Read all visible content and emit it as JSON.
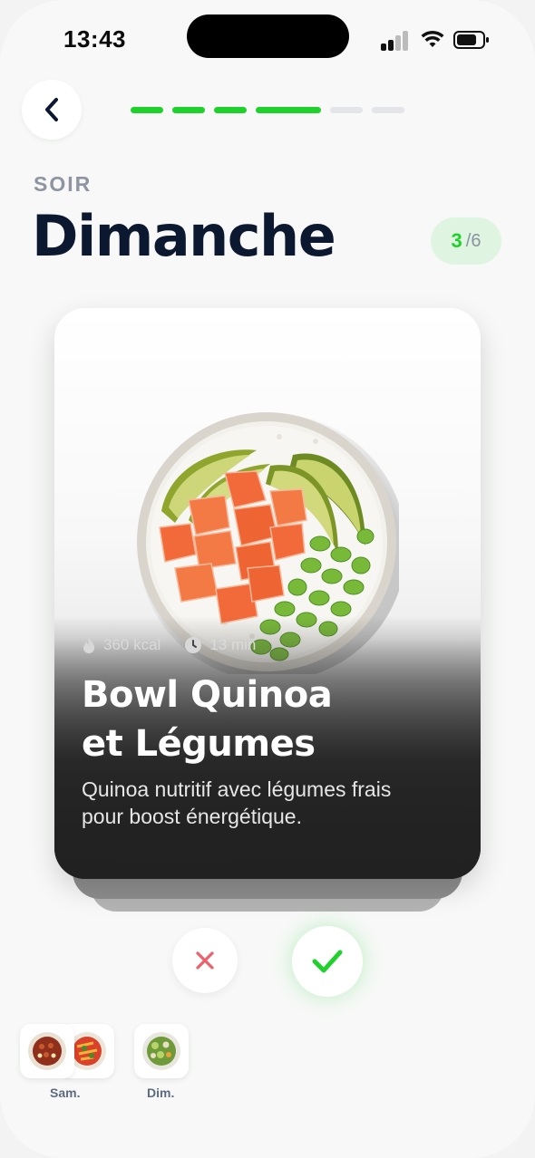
{
  "status_bar": {
    "time": "13:43"
  },
  "header": {
    "progress": {
      "total_steps": 6,
      "completed_steps": 4,
      "current_step": 4
    },
    "meal_label": "SOIR",
    "day_title": "Dimanche",
    "counter": {
      "current": "3",
      "total": "/6"
    }
  },
  "card": {
    "calories": "360 kcal",
    "duration": "13 min",
    "title_line1": "Bowl Quinoa",
    "title_line2": "et Légumes",
    "description_line1": "Quinoa nutritif avec légumes frais",
    "description_line2": "pour boost énergétique."
  },
  "history": [
    {
      "label": "Sam."
    },
    {
      "label": "Dim."
    }
  ],
  "colors": {
    "accent_green": "#1fd12b",
    "reject_red": "#f0606a",
    "inactive_segment": "#e3e5e8"
  }
}
